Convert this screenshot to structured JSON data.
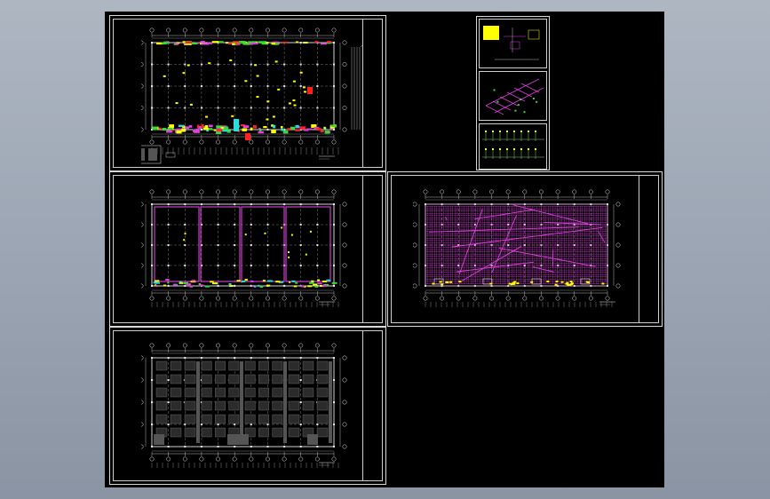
{
  "app": {
    "background_color": "#000000",
    "frame_color": "#d8d8d8"
  },
  "colors": {
    "line": "#e6e6e6",
    "grid_dash": "#9a9a9a",
    "magenta": "#e040e0",
    "yellow": "#ffff00",
    "green": "#33dd33",
    "red": "#ff2020",
    "cyan": "#20e0e0",
    "gray_block": "#555555"
  },
  "sheets": [
    {
      "id": "sheet-1",
      "kind": "plan-detailed"
    },
    {
      "id": "sheet-2",
      "kind": "plan-magenta-outline"
    },
    {
      "id": "sheet-3",
      "kind": "plan-magenta-fill"
    },
    {
      "id": "sheet-4",
      "kind": "plan-gray-blocks"
    },
    {
      "id": "sheet-5",
      "kind": "detail-stack"
    }
  ]
}
